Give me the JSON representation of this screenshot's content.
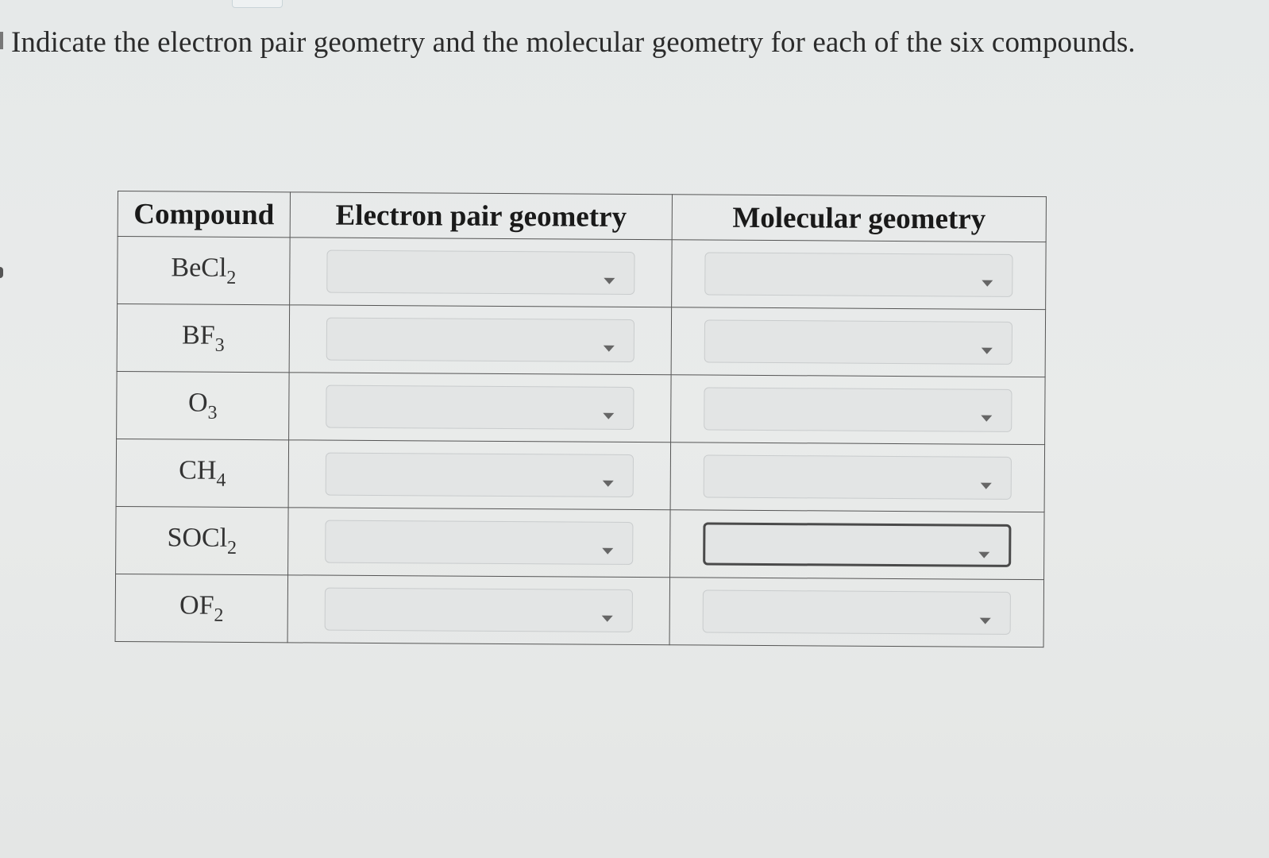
{
  "question": {
    "prompt": "Indicate the electron pair geometry and the molecular geometry for each of the six compounds."
  },
  "table": {
    "headers": {
      "compound": "Compound",
      "electron_pair_geometry": "Electron pair geometry",
      "molecular_geometry": "Molecular geometry"
    },
    "rows": [
      {
        "formula_base": "BeCl",
        "subscript": "2",
        "electron_pair_geometry": "",
        "molecular_geometry": ""
      },
      {
        "formula_base": "BF",
        "subscript": "3",
        "electron_pair_geometry": "",
        "molecular_geometry": ""
      },
      {
        "formula_base": "O",
        "subscript": "3",
        "electron_pair_geometry": "",
        "molecular_geometry": ""
      },
      {
        "formula_base": "CH",
        "subscript": "4",
        "electron_pair_geometry": "",
        "molecular_geometry": ""
      },
      {
        "formula_base": "SOCl",
        "subscript": "2",
        "electron_pair_geometry": "",
        "molecular_geometry": "",
        "molecular_geometry_focused": true
      },
      {
        "formula_base": "OF",
        "subscript": "2",
        "electron_pair_geometry": "",
        "molecular_geometry": ""
      }
    ]
  },
  "icons": {
    "dropdown": "chevron-down-icon"
  }
}
